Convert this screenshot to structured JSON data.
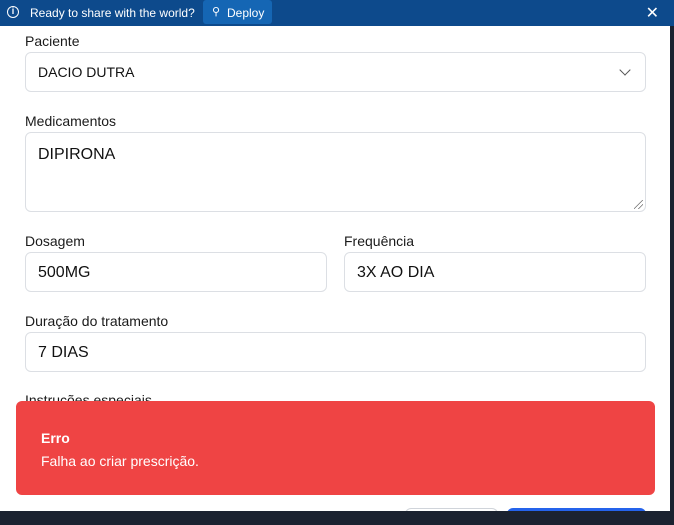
{
  "topbar": {
    "message": "Ready to share with the world?",
    "deploy_label": "Deploy",
    "close_glyph": "✕"
  },
  "form": {
    "paciente": {
      "label": "Paciente",
      "value": "DACIO DUTRA"
    },
    "medicamentos": {
      "label": "Medicamentos",
      "value": "DIPIRONA"
    },
    "dosagem": {
      "label": "Dosagem",
      "value": "500MG"
    },
    "frequencia": {
      "label": "Frequência",
      "value": "3X AO DIA"
    },
    "duracao": {
      "label": "Duração do tratamento",
      "value": "7 DIAS"
    },
    "instrucoes": {
      "label": "Instruções especiais"
    }
  },
  "toast": {
    "title": "Erro",
    "description": "Falha ao criar prescrição.",
    "color": "#ef4444"
  },
  "colors": {
    "topbar": "#0d4a8c",
    "deploy_button": "#1566b4",
    "primary_button": "#2563eb"
  }
}
